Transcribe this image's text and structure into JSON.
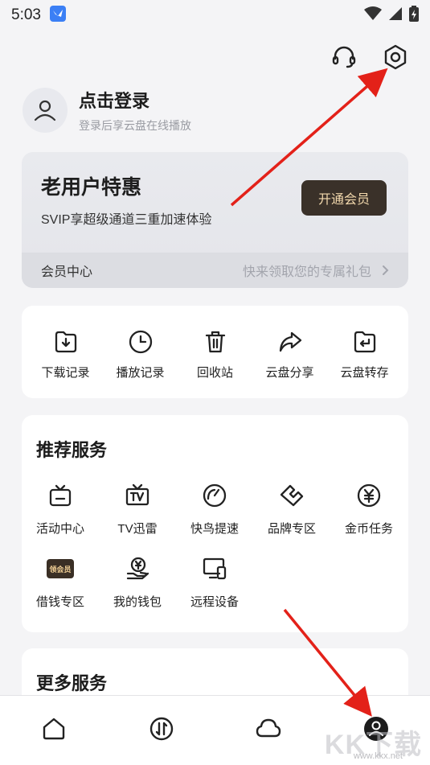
{
  "status": {
    "time": "5:03"
  },
  "profile": {
    "title": "点击登录",
    "subtitle": "登录后享云盘在线播放"
  },
  "vip": {
    "title": "老用户特惠",
    "desc": "SVIP享超级通道三重加速体验",
    "button": "开通会员",
    "center": "会员中心",
    "gift": "快来领取您的专属礼包"
  },
  "quick_tools": [
    {
      "label": "下载记录",
      "icon": "download-folder-icon"
    },
    {
      "label": "播放记录",
      "icon": "clock-icon"
    },
    {
      "label": "回收站",
      "icon": "trash-icon"
    },
    {
      "label": "云盘分享",
      "icon": "share-arrow-icon"
    },
    {
      "label": "云盘转存",
      "icon": "transfer-folder-icon"
    }
  ],
  "services": {
    "title": "推荐服务",
    "items": [
      {
        "label": "活动中心",
        "icon": "tv-box-icon"
      },
      {
        "label": "TV迅雷",
        "icon": "tv-icon"
      },
      {
        "label": "快鸟提速",
        "icon": "speedometer-icon"
      },
      {
        "label": "品牌专区",
        "icon": "handshake-icon"
      },
      {
        "label": "金币任务",
        "icon": "yen-coin-icon"
      },
      {
        "label": "借钱专区",
        "icon": "vip-badge-icon",
        "badge": "领会员"
      },
      {
        "label": "我的钱包",
        "icon": "wallet-hand-icon"
      },
      {
        "label": "远程设备",
        "icon": "remote-device-icon"
      }
    ]
  },
  "more": {
    "title": "更多服务"
  },
  "tabbar": [
    {
      "icon": "home-icon"
    },
    {
      "icon": "transfer-icon"
    },
    {
      "icon": "cloud-icon"
    },
    {
      "icon": "profile-icon"
    }
  ],
  "watermark": {
    "text": "KK下载",
    "url": "www.kkx.net"
  },
  "colors": {
    "annotation_arrow": "#e32119",
    "vip_button_bg": "#3a3129",
    "vip_button_text": "#f3d9ad"
  }
}
